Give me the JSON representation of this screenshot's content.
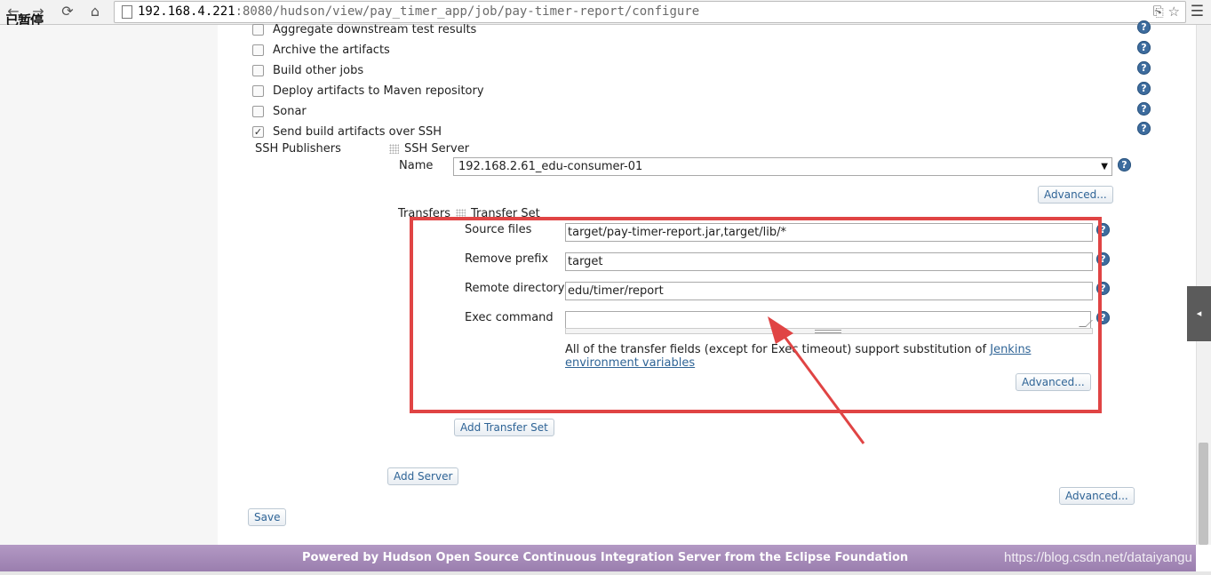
{
  "browser": {
    "url_host": "192.168.4.221",
    "url_rest": ":8080/hudson/view/pay_timer_app/job/pay-timer-report/configure",
    "paused_overlay": "已暂停"
  },
  "post_build_actions": [
    {
      "label": "Aggregate downstream test results",
      "checked": false
    },
    {
      "label": "Archive the artifacts",
      "checked": false
    },
    {
      "label": "Build other jobs",
      "checked": false
    },
    {
      "label": "Deploy artifacts to Maven repository",
      "checked": false
    },
    {
      "label": "Sonar",
      "checked": false
    },
    {
      "label": "Send build artifacts over SSH",
      "checked": true
    }
  ],
  "ssh": {
    "publishers_label": "SSH Publishers",
    "server_label": "SSH Server",
    "name_label": "Name",
    "name_value": "192.168.2.61_edu-consumer-01",
    "advanced_label": "Advanced...",
    "transfers_label": "Transfers",
    "transfer_set_label": "Transfer Set",
    "source_files_label": "Source files",
    "source_files_value": "target/pay-timer-report.jar,target/lib/*",
    "remove_prefix_label": "Remove prefix",
    "remove_prefix_value": "target",
    "remote_directory_label": "Remote directory",
    "remote_directory_value": "edu/timer/report",
    "exec_command_label": "Exec command",
    "exec_command_value": "",
    "info_text": "All of the transfer fields (except for Exec timeout) support substitution of ",
    "info_link": "Jenkins environment variables",
    "transfer_advanced_label": "Advanced...",
    "add_transfer_set_label": "Add Transfer Set",
    "add_server_label": "Add Server",
    "outer_advanced_label": "Advanced..."
  },
  "save_label": "Save",
  "footer_text": "Powered by Hudson Open Source Continuous Integration Server from the Eclipse Foundation",
  "watermark": "https://blog.csdn.net/dataiyangu",
  "colors": {
    "highlight": "#e04444",
    "help_icon": "#3d6c9e",
    "footer": "#a98bbd"
  }
}
